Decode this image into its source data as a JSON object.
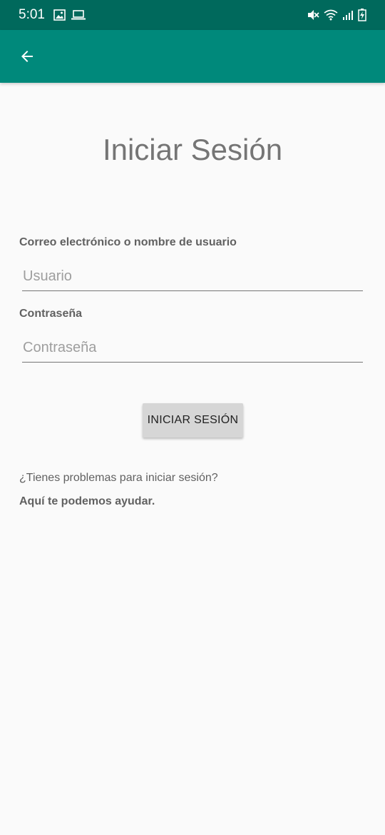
{
  "status_bar": {
    "time": "5:01",
    "left_icons": [
      "image-icon",
      "laptop-icon"
    ],
    "right_icons": [
      "mute-icon",
      "wifi-icon",
      "signal-icon",
      "battery-charging-icon"
    ]
  },
  "app_bar": {
    "back_icon": "arrow-back-icon",
    "background": "#00897b",
    "status_background": "#00695c"
  },
  "login": {
    "title": "Iniciar Sesión",
    "username_label": "Correo electrónico o nombre de usuario",
    "username_placeholder": "Usuario",
    "username_value": "",
    "password_label": "Contraseña",
    "password_placeholder": "Contraseña",
    "password_value": "",
    "submit_label": "INICIAR SESIÓN",
    "help_text": "¿Tienes problemas para iniciar sesión?",
    "help_link": "Aquí te podemos ayudar."
  }
}
